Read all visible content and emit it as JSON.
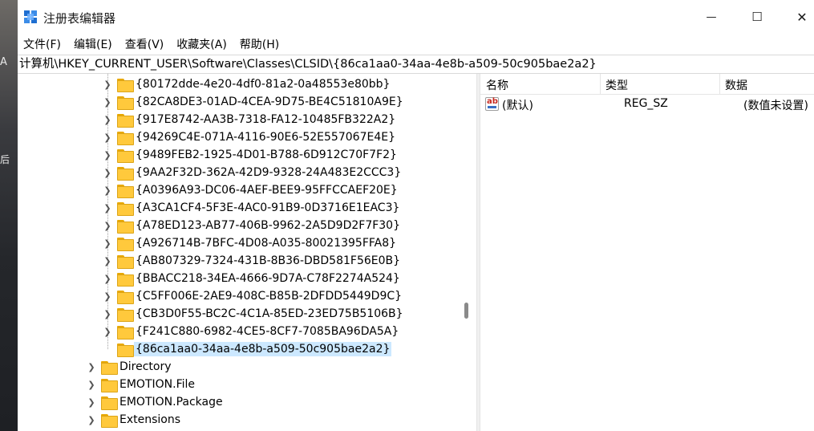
{
  "window": {
    "title": "注册表编辑器",
    "controls": {
      "minimize": "—",
      "maximize": "☐",
      "close": "✕"
    }
  },
  "desktop_fragments": [
    "A",
    "后"
  ],
  "menu": [
    "文件(F)",
    "编辑(E)",
    "查看(V)",
    "收藏夹(A)",
    "帮助(H)"
  ],
  "address": "计算机\\HKEY_CURRENT_USER\\Software\\Classes\\CLSID\\{86ca1aa0-34aa-4e8b-a509-50c905bae2a2}",
  "tree": {
    "clsid_children": [
      "{80172dde-4e20-4df0-81a2-0a48553e80bb}",
      "{82CA8DE3-01AD-4CEA-9D75-BE4C51810A9E}",
      "{917E8742-AA3B-7318-FA12-10485FB322A2}",
      "{94269C4E-071A-4116-90E6-52E557067E4E}",
      "{9489FEB2-1925-4D01-B788-6D912C70F7F2}",
      "{9AA2F32D-362A-42D9-9328-24A483E2CCC3}",
      "{A0396A93-DC06-4AEF-BEE9-95FFCCAEF20E}",
      "{A3CA1CF4-5F3E-4AC0-91B9-0D3716E1EAC3}",
      "{A78ED123-AB77-406B-9962-2A5D9D2F7F30}",
      "{A926714B-7BFC-4D08-A035-80021395FFA8}",
      "{AB807329-7324-431B-8B36-DBD581F56E0B}",
      "{BBACC218-34EA-4666-9D7A-C78F2274A524}",
      "{C5FF006E-2AE9-408C-B85B-2DFDD5449D9C}",
      "{CB3D0F55-BC2C-4C1A-85ED-23ED75B5106B}",
      "{F241C880-6982-4CE5-8CF7-7085BA96DA5A}"
    ],
    "selected": "{86ca1aa0-34aa-4e8b-a509-50c905bae2a2}",
    "classes_children": [
      "Directory",
      "EMOTION.File",
      "EMOTION.Package",
      "Extensions"
    ],
    "chevron": "❯"
  },
  "list": {
    "headers": {
      "name": "名称",
      "type": "类型",
      "data": "数据"
    },
    "rows": [
      {
        "icon": "ab-string-icon",
        "name": "(默认)",
        "type": "REG_SZ",
        "data": "(数值未设置)"
      }
    ]
  },
  "colors": {
    "selection": "#cce8ff",
    "folder": "#ffc93c"
  }
}
